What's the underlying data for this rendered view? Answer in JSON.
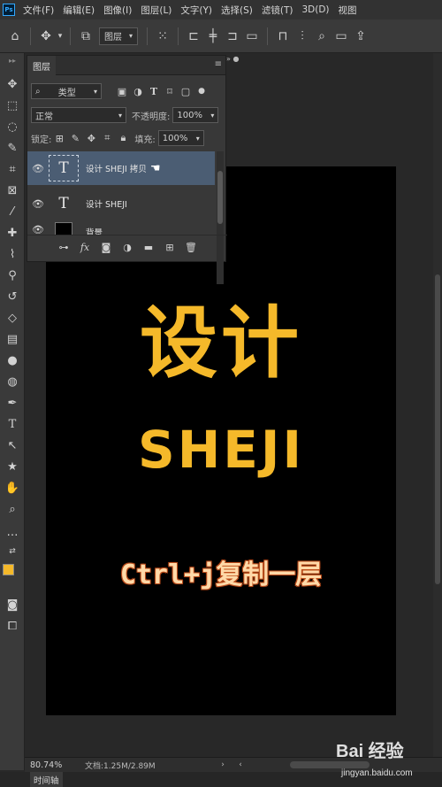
{
  "app": {
    "logo": "Ps"
  },
  "menu": [
    "文件(F)",
    "编辑(E)",
    "图像(I)",
    "图层(L)",
    "文字(Y)",
    "选择(S)",
    "滤镜(T)",
    "3D(D)",
    "视图"
  ],
  "options_bar": {
    "layer_select": "图层",
    "icons": [
      "home-icon",
      "move-icon",
      "auto-select-icon",
      "layer-select",
      "transform-controls-icon",
      "align-left-icon",
      "align-center-icon",
      "align-right-icon",
      "distribute-icon",
      "align-top-icon",
      "align-middle-icon",
      "search-icon",
      "workspace-icon",
      "share-icon"
    ]
  },
  "tools": [
    "move",
    "marquee",
    "lasso",
    "quick-select",
    "crop",
    "frame",
    "eyedropper",
    "healing",
    "brush",
    "clone-stamp",
    "history-brush",
    "eraser",
    "gradient",
    "blur",
    "dodge",
    "pen",
    "type",
    "path-select",
    "shape",
    "hand",
    "zoom",
    "more",
    "swap-colors"
  ],
  "colors": {
    "foreground": "#f5b92a",
    "background": "#ffffff",
    "canvas_text": "#f5b92a",
    "selection": "#4b5d73"
  },
  "layers_panel": {
    "tab_label": "图层",
    "filter_label": "类型",
    "blend_mode": "正常",
    "opacity_label": "不透明度:",
    "opacity_value": "100%",
    "lock_label": "锁定:",
    "fill_label": "填充:",
    "fill_value": "100%",
    "layers": [
      {
        "name": "设计 SHEJI 拷贝",
        "type": "text",
        "visible": true,
        "selected": true
      },
      {
        "name": "设计 SHEJI",
        "type": "text",
        "visible": true,
        "selected": false
      },
      {
        "name": "背景",
        "type": "fill",
        "visible": true,
        "selected": false
      }
    ],
    "footer_icons": [
      "link-icon",
      "fx-icon",
      "mask-icon",
      "adjustment-icon",
      "group-icon",
      "new-layer-icon",
      "trash-icon"
    ],
    "footer_fx": "fx"
  },
  "canvas": {
    "headline": "设计",
    "subtitle": "SHEJI",
    "caption": "Ctrl+j复制一层"
  },
  "status_bar": {
    "zoom": "80.74%",
    "doc_info": "文档:1.25M/2.89M"
  },
  "timeline_tab": "时间轴",
  "watermark": {
    "brand": "Bai 经验",
    "url": "jingyan.baidu.com"
  }
}
